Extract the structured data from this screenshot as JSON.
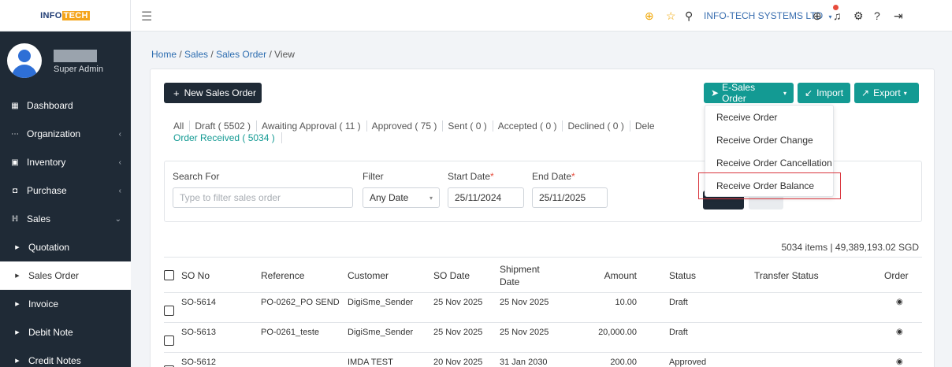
{
  "logo": {
    "part1": "INFO",
    "part2": "TECH"
  },
  "profile": {
    "role": "Super Admin"
  },
  "sidebar": {
    "items": [
      {
        "label": "Dashboard",
        "icon": "grid-icon"
      },
      {
        "label": "Organization",
        "icon": "dots-icon"
      },
      {
        "label": "Inventory",
        "icon": "box-icon"
      },
      {
        "label": "Purchase",
        "icon": "bag-icon"
      },
      {
        "label": "Sales",
        "icon": "cart-icon"
      },
      {
        "label": "Quotation"
      },
      {
        "label": "Sales Order"
      },
      {
        "label": "Invoice"
      },
      {
        "label": "Debit Note"
      },
      {
        "label": "Credit Notes"
      }
    ]
  },
  "topbar": {
    "company": "INFO-TECH SYSTEMS LTD"
  },
  "breadcrumb": {
    "home": "Home",
    "sales": "Sales",
    "sales_order": "Sales Order",
    "view": "View"
  },
  "toolbar": {
    "new_label": "New Sales Order",
    "esales_label": "E-Sales Order",
    "import_label": "Import",
    "export_label": "Export"
  },
  "tabs": [
    "All",
    "Draft ( 5502 )",
    "Awaiting Approval ( 11 )",
    "Approved ( 75 )",
    "Sent ( 0 )",
    "Accepted ( 0 )",
    "Declined ( 0 )",
    "Dele"
  ],
  "tab_second": "Order Received ( 5034 )",
  "filters": {
    "search_label": "Search For",
    "search_placeholder": "Type to filter sales order",
    "filter_label": "Filter",
    "filter_value": "Any Date",
    "start_label": "Start Date",
    "start_value": "25/11/2024",
    "end_label": "End Date",
    "end_value": "25/11/2025",
    "required_mark": "*"
  },
  "summary": "5034 items | 49,389,193.02 SGD",
  "table": {
    "headers": {
      "so_no": "SO No",
      "reference": "Reference",
      "customer": "Customer",
      "so_date": "SO Date",
      "shipment1": "Shipment",
      "shipment2": "Date",
      "amount": "Amount",
      "status": "Status",
      "transfer": "Transfer Status",
      "order": "Order"
    },
    "rows": [
      {
        "so_no": "SO-5614",
        "reference": "PO-0262_PO SEND",
        "customer": "DigiSme_Sender",
        "so_date": "25 Nov 2025",
        "shipment": "25 Nov 2025",
        "amount": "10.00",
        "status": "Draft"
      },
      {
        "so_no": "SO-5613",
        "reference": "PO-0261_teste",
        "customer": "DigiSme_Sender",
        "so_date": "25 Nov 2025",
        "shipment": "25 Nov 2025",
        "amount": "20,000.00",
        "status": "Draft"
      },
      {
        "so_no": "SO-5612",
        "reference": "",
        "customer": "IMDA TEST",
        "so_date": "20 Nov 2025",
        "shipment": "31 Jan 2030",
        "amount": "200.00",
        "status": "Approved"
      }
    ]
  },
  "dropdown": {
    "items": [
      "Receive Order",
      "Receive Order Change",
      "Receive Order Cancellation",
      "Receive Order Balance"
    ]
  },
  "colors": {
    "sidebar": "#1f2a36",
    "accent": "#139a93",
    "highlight": "#d9363e"
  }
}
